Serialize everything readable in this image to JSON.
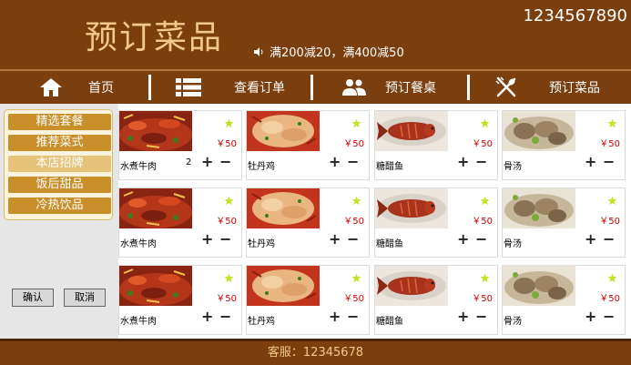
{
  "header": {
    "title": "预订菜品",
    "phone": "1234567890",
    "promo": "满200减20，满400减50"
  },
  "nav": [
    {
      "label": "首页",
      "icon": "home-icon"
    },
    {
      "label": "查看订单",
      "icon": "list-icon"
    },
    {
      "label": "预订餐桌",
      "icon": "people-icon"
    },
    {
      "label": "预订菜品",
      "icon": "fork-spoon-icon"
    }
  ],
  "sidebar": {
    "categories": [
      "精选套餐",
      "推荐菜式",
      "本店招牌",
      "饭后甜品",
      "冷热饮品"
    ],
    "active_index": 2,
    "confirm_label": "确认",
    "cancel_label": "取消"
  },
  "grid": {
    "rows": [
      [
        {
          "name": "水煮牛肉",
          "price": "￥50",
          "qty": "2",
          "kind": "beef"
        },
        {
          "name": "牡丹鸡",
          "price": "￥50",
          "qty": "",
          "kind": "chicken"
        },
        {
          "name": "糖醋鱼",
          "price": "￥50",
          "qty": "",
          "kind": "fish"
        },
        {
          "name": "骨汤",
          "price": "￥50",
          "qty": "",
          "kind": "soup"
        }
      ],
      [
        {
          "name": "水煮牛肉",
          "price": "￥50",
          "qty": "",
          "kind": "beef"
        },
        {
          "name": "牡丹鸡",
          "price": "￥50",
          "qty": "",
          "kind": "chicken"
        },
        {
          "name": "糖醋鱼",
          "price": "￥50",
          "qty": "",
          "kind": "fish"
        },
        {
          "name": "骨汤",
          "price": "￥50",
          "qty": "",
          "kind": "soup"
        }
      ],
      [
        {
          "name": "水煮牛肉",
          "price": "￥50",
          "qty": "",
          "kind": "beef"
        },
        {
          "name": "牡丹鸡",
          "price": "￥50",
          "qty": "",
          "kind": "chicken"
        },
        {
          "name": "糖醋鱼",
          "price": "￥50",
          "qty": "",
          "kind": "fish"
        },
        {
          "name": "骨汤",
          "price": "￥50",
          "qty": "",
          "kind": "soup"
        }
      ]
    ],
    "plus_label": "+",
    "minus_label": "−"
  },
  "footer": {
    "service": "客服：12345678"
  },
  "colors": {
    "brand": "#7b3e0e",
    "title": "#f1c98b",
    "category": "#c98f2a",
    "category_active": "#e6c27b",
    "price": "#d40000",
    "star": "#c8e026"
  }
}
